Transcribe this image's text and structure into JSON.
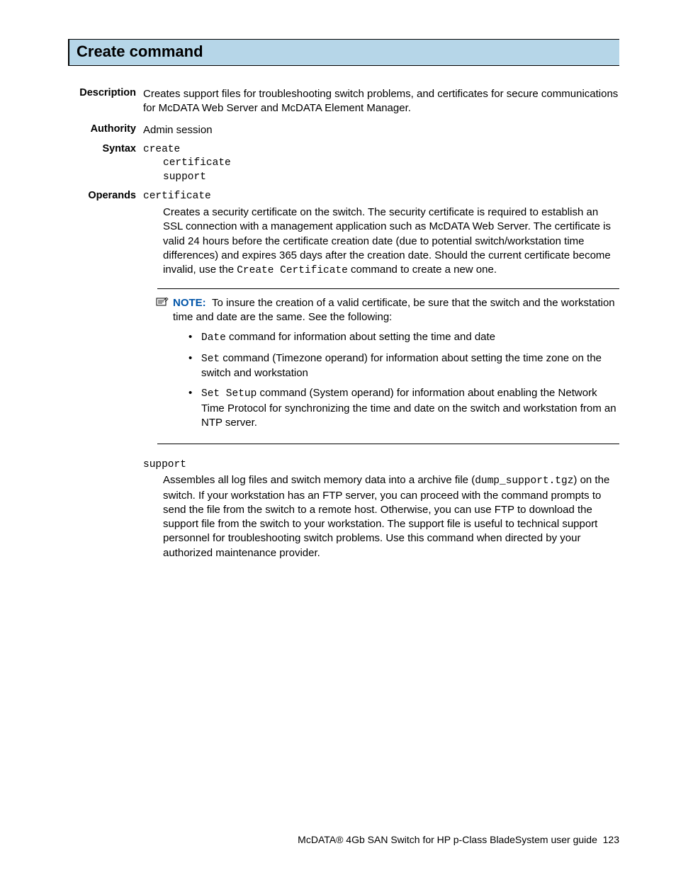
{
  "title": "Create command",
  "sections": {
    "description": {
      "label": "Description",
      "text": "Creates support files for troubleshooting switch problems, and certificates for secure communications for McDATA Web Server and McDATA Element Manager."
    },
    "authority": {
      "label": "Authority",
      "text": "Admin session"
    },
    "syntax": {
      "label": "Syntax",
      "cmd": "create",
      "args": [
        "certificate",
        "support"
      ]
    },
    "operands": {
      "label": "Operands",
      "items": [
        {
          "name": "certificate",
          "desc_parts": [
            "Creates a security certificate on the switch. The security certificate is required to establish an SSL connection with a management application such as McDATA Web Server. The certificate is valid 24 hours before the certificate creation date (due to potential switch/workstation time differences) and expires 365 days after the creation date. Should the current certificate become invalid, use the ",
            "Create Certificate",
            " command to create a new one."
          ]
        },
        {
          "name": "support",
          "desc_parts": [
            "Assembles all log files and switch memory data into a archive file (",
            "dump_support.tgz",
            ") on the switch. If your workstation has an FTP server, you can proceed with the command prompts to send the file from the switch to a remote host. Otherwise, you can use FTP to download the support file from the switch to your workstation. The support file is useful to technical support personnel for troubleshooting switch problems. Use this command when directed by your authorized maintenance provider."
          ]
        }
      ]
    }
  },
  "note": {
    "label": "NOTE:",
    "intro": "To insure the creation of a valid certificate, be sure that the switch and the workstation time and date are the same. See the following:",
    "bullets": [
      {
        "cmd": "Date",
        "rest": " command for information about setting the time and date"
      },
      {
        "cmd": "Set",
        "rest": " command (Timezone operand) for information about setting the time zone on the switch and workstation"
      },
      {
        "cmd": "Set Setup",
        "rest": " command (System operand) for information about enabling the Network Time Protocol for synchronizing the time and date on the switch and workstation from an NTP server."
      }
    ]
  },
  "footer": {
    "text": "McDATA® 4Gb SAN Switch for HP p-Class BladeSystem user guide",
    "page": "123"
  }
}
